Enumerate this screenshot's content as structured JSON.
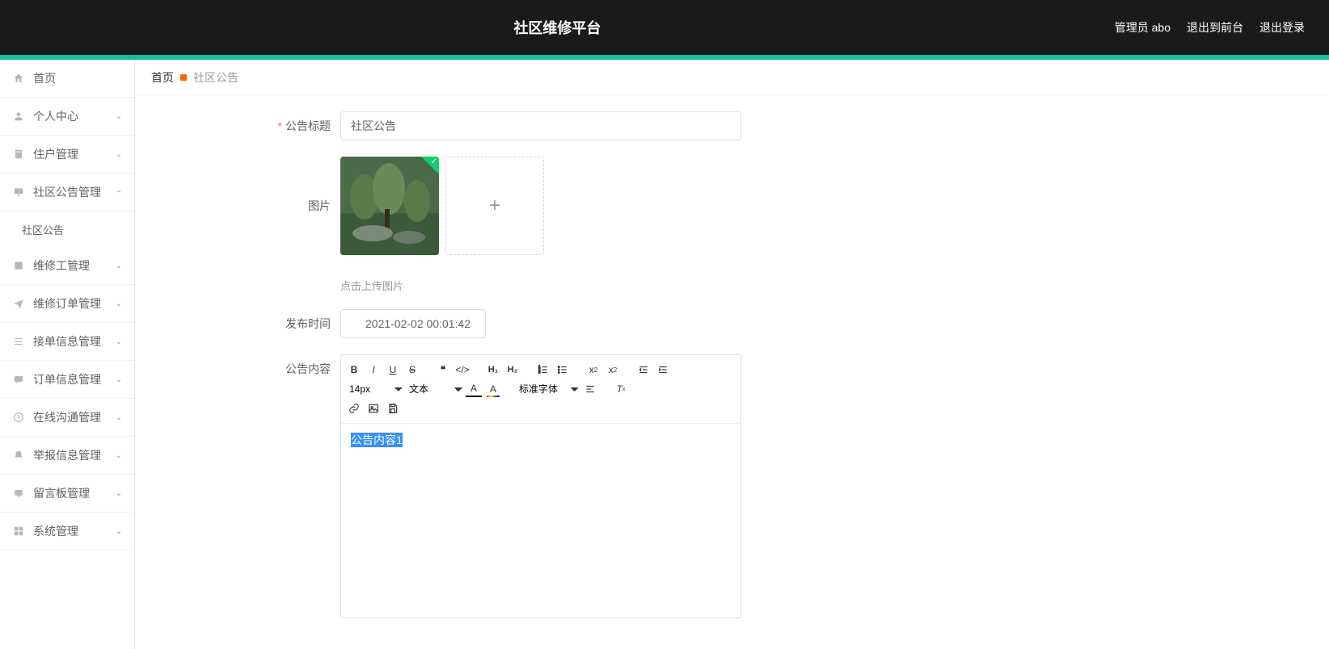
{
  "header": {
    "title": "社区维修平台",
    "admin_label": "管理员 abo",
    "back_frontend": "退出到前台",
    "logout": "退出登录"
  },
  "sidebar": {
    "home": "首页",
    "personal": "个人中心",
    "resident": "住户管理",
    "announce_mgmt": "社区公告管理",
    "announce_sub": "社区公告",
    "repairman": "维修工管理",
    "repair_order": "维修订单管理",
    "accept_order": "接单信息管理",
    "order_info": "订单信息管理",
    "online_comm": "在线沟通管理",
    "report": "举报信息管理",
    "message_board": "留言板管理",
    "system": "系统管理"
  },
  "breadcrumb": {
    "home": "首页",
    "current": "社区公告"
  },
  "form": {
    "title_label": "公告标题",
    "title_value": "社区公告",
    "image_label": "图片",
    "upload_hint": "点击上传图片",
    "publish_time_label": "发布时间",
    "publish_time_value": "2021-02-02 00:01:42",
    "content_label": "公告内容",
    "content_value": "公告内容1"
  },
  "editor_toolbar": {
    "font_size": "14px",
    "block_type": "文本",
    "font_family": "标准字体"
  }
}
